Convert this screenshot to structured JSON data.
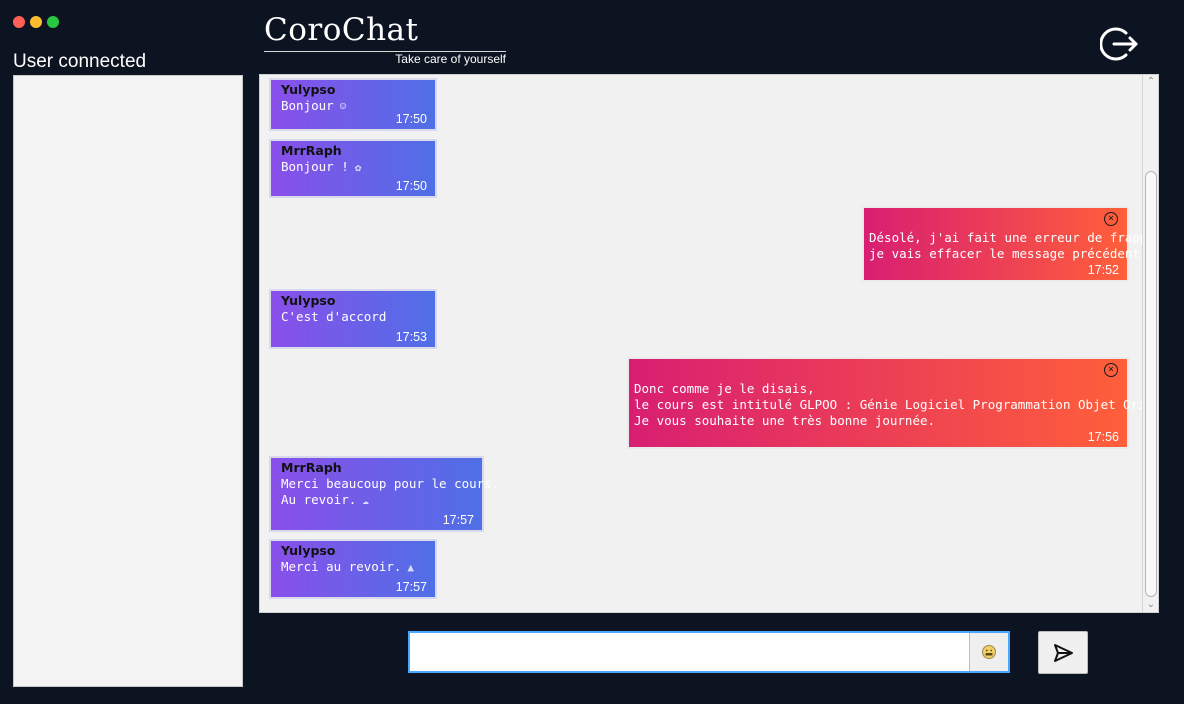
{
  "window": {
    "controls": {
      "close_color": "#ff5f57",
      "minimize_color": "#febc2e",
      "maximize_color": "#28c840"
    }
  },
  "sidebar": {
    "title": "User connected",
    "users": []
  },
  "brand": {
    "title": "CoroChat",
    "tagline": "Take care of yourself"
  },
  "header": {
    "logout_icon": "logout-icon"
  },
  "messages": [
    {
      "author": "Yulypso",
      "lines": [
        "Bonjour"
      ],
      "emoji": "smile-icon",
      "time": "17:50",
      "direction": "in"
    },
    {
      "author": "MrrRaph",
      "lines": [
        "Bonjour !"
      ],
      "emoji": "cat-icon",
      "time": "17:50",
      "direction": "in"
    },
    {
      "author": "",
      "lines": [
        "Désolé, j'ai fait une erreur de frappe,",
        "je vais effacer le message précédent."
      ],
      "time": "17:52",
      "direction": "out"
    },
    {
      "author": "Yulypso",
      "lines": [
        "C'est d'accord"
      ],
      "time": "17:53",
      "direction": "in"
    },
    {
      "author": "",
      "lines": [
        "Donc comme je le disais,",
        "le cours est intitulé GLPOO : Génie Logiciel Programmation Objet Orienté.",
        "Je vous souhaite une très bonne journée."
      ],
      "time": "17:56",
      "direction": "out"
    },
    {
      "author": "MrrRaph",
      "lines": [
        "Merci beaucoup pour le cours.",
        "Au revoir."
      ],
      "emoji": "ghost-icon",
      "time": "17:57",
      "direction": "in"
    },
    {
      "author": "Yulypso",
      "lines": [
        "Merci au revoir."
      ],
      "emoji": "rocket-icon",
      "time": "17:57",
      "direction": "in"
    }
  ],
  "composer": {
    "value": "",
    "placeholder": "",
    "emoji_icon": "emoji-icon",
    "send_icon": "send-icon"
  },
  "colors": {
    "background": "#0c1321",
    "incoming_start": "#8a4fea",
    "incoming_end": "#4f6fe6",
    "outgoing_start": "#d81e72",
    "outgoing_end": "#ff5f3a",
    "input_focus": "#4aa6ff"
  }
}
